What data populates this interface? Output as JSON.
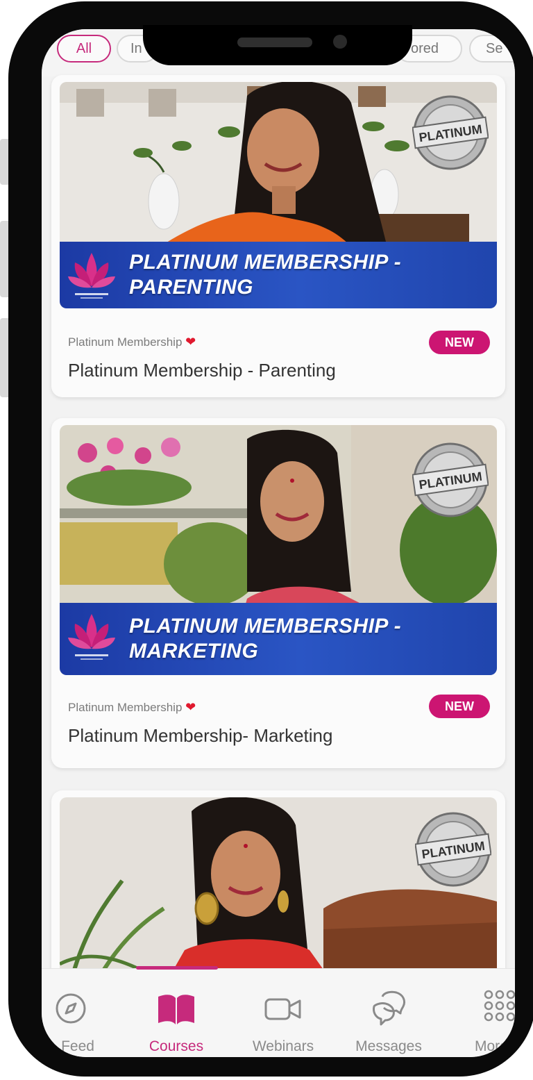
{
  "filters": {
    "chips": [
      "All",
      "In",
      "ored",
      "Se"
    ]
  },
  "courses": [
    {
      "banner_title": "PLATINUM MEMBERSHIP - PARENTING",
      "banner_line1": "PLATINUM MEMBERSHIP -",
      "banner_line2": "PARENTING",
      "seal_text": "PLATINUM",
      "category": "Platinum Membership",
      "badge": "NEW",
      "title": "Platinum Membership - Parenting"
    },
    {
      "banner_title": "PLATINUM MEMBERSHIP - MARKETING",
      "banner_line1": "PLATINUM MEMBERSHIP -",
      "banner_line2": "MARKETING",
      "seal_text": "PLATINUM",
      "category": "Platinum Membership",
      "badge": "NEW",
      "title": "Platinum Membership- Marketing"
    },
    {
      "seal_text": "PLATINUM"
    }
  ],
  "tabs": [
    {
      "label": "Feed",
      "icon": "compass-icon"
    },
    {
      "label": "Courses",
      "icon": "book-icon",
      "active": true
    },
    {
      "label": "Webinars",
      "icon": "video-camera-icon"
    },
    {
      "label": "Messages",
      "icon": "chat-bubbles-icon"
    },
    {
      "label": "More",
      "icon": "grid-dots-icon"
    }
  ],
  "colors": {
    "accent": "#c62a7c",
    "badge": "#cc1572",
    "banner": "#2a55c4"
  }
}
